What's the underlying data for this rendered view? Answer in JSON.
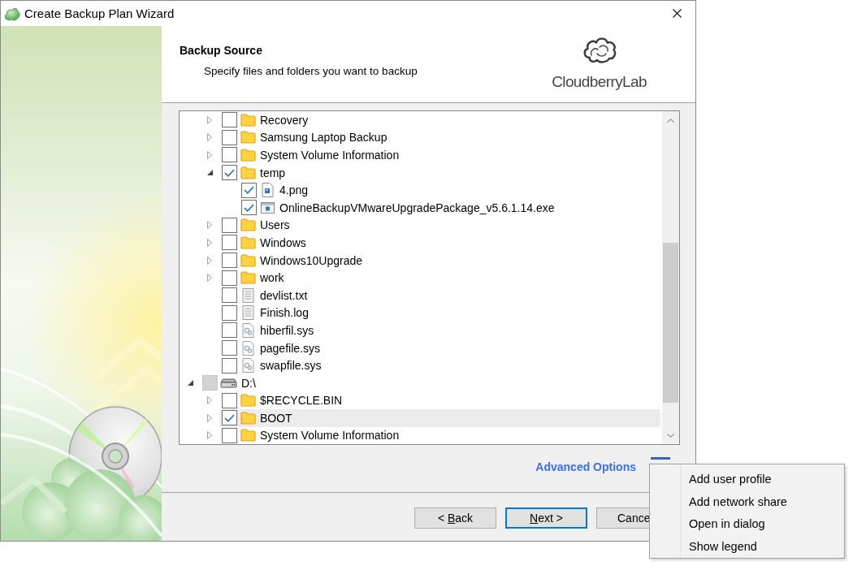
{
  "window": {
    "title": "Create Backup Plan Wizard"
  },
  "header": {
    "title": "Backup Source",
    "subtitle": "Specify files and folders you want to backup",
    "logo_text": "CloudberryLab"
  },
  "tree": {
    "items": [
      {
        "children": [
          {
            "label": "Recovery",
            "kind": "folder",
            "expanded": false,
            "checked": false,
            "partial": false,
            "selected": false
          },
          {
            "label": "Samsung Laptop Backup",
            "kind": "folder",
            "expanded": false,
            "checked": false,
            "partial": false,
            "selected": false
          },
          {
            "label": "System Volume Information",
            "kind": "folder",
            "expanded": false,
            "checked": false,
            "partial": false,
            "selected": false
          },
          {
            "label": "temp",
            "kind": "folder",
            "expanded": true,
            "checked": true,
            "partial": false,
            "selected": false,
            "children": [
              {
                "label": "4.png",
                "kind": "image-file",
                "checked": true,
                "partial": false,
                "selected": false
              },
              {
                "label": "OnlineBackupVMwareUpgradePackage_v5.6.1.14.exe",
                "kind": "program-file",
                "checked": true,
                "partial": false,
                "selected": false
              }
            ]
          },
          {
            "label": "Users",
            "kind": "folder",
            "expanded": false,
            "checked": false,
            "partial": false,
            "selected": false
          },
          {
            "label": "Windows",
            "kind": "folder",
            "expanded": false,
            "checked": false,
            "partial": false,
            "selected": false
          },
          {
            "label": "Windows10Upgrade",
            "kind": "folder",
            "expanded": false,
            "checked": false,
            "partial": false,
            "selected": false
          },
          {
            "label": "work",
            "kind": "folder",
            "expanded": false,
            "checked": false,
            "partial": false,
            "selected": false
          },
          {
            "label": "devlist.txt",
            "kind": "text-file",
            "checked": false,
            "partial": false,
            "selected": false
          },
          {
            "label": "Finish.log",
            "kind": "text-file",
            "checked": false,
            "partial": false,
            "selected": false
          },
          {
            "label": "hiberfil.sys",
            "kind": "system-file",
            "checked": false,
            "partial": false,
            "selected": false
          },
          {
            "label": "pagefile.sys",
            "kind": "system-file",
            "checked": false,
            "partial": false,
            "selected": false
          },
          {
            "label": "swapfile.sys",
            "kind": "system-file",
            "checked": false,
            "partial": false,
            "selected": false
          }
        ]
      },
      {
        "label": "D:\\",
        "kind": "drive",
        "expanded": true,
        "checked": false,
        "partial": true,
        "selected": false,
        "children": [
          {
            "label": "$RECYCLE.BIN",
            "kind": "folder",
            "expanded": false,
            "checked": false,
            "partial": false,
            "selected": false
          },
          {
            "label": "BOOT",
            "kind": "folder",
            "expanded": false,
            "checked": true,
            "partial": false,
            "selected": true
          },
          {
            "label": "System Volume Information",
            "kind": "folder",
            "expanded": false,
            "checked": false,
            "partial": false,
            "selected": false
          }
        ]
      }
    ]
  },
  "advanced_options": {
    "label": "Advanced Options"
  },
  "buttons": [
    {
      "text_before": "< ",
      "access_key": "B",
      "text_after": "ack",
      "focused": false
    },
    {
      "access_key": "N",
      "text_after": "ext >",
      "focused": true
    },
    {
      "text_before": "Cance",
      "focused": false
    }
  ],
  "context_menu": {
    "items": [
      {
        "label": "Add user profile"
      },
      {
        "label": "Add network share"
      },
      {
        "label": "Open in dialog"
      },
      {
        "label": "Show legend"
      }
    ]
  }
}
